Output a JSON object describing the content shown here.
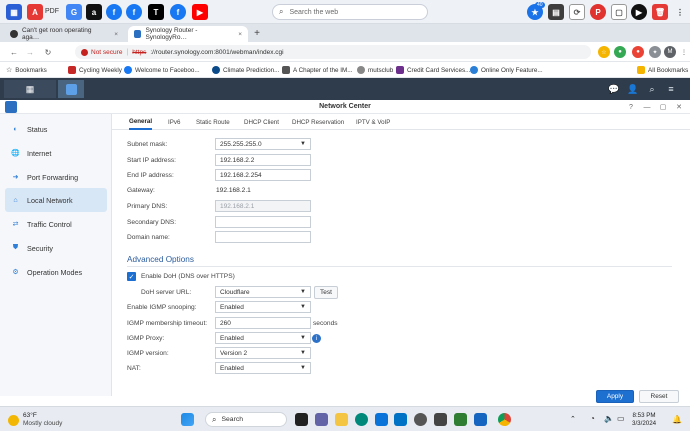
{
  "topbar": {
    "pdf_label": "PDF",
    "search_placeholder": "Search the web",
    "notif_badge": "40"
  },
  "tabs": [
    {
      "label": "Can't get roon operating aga…",
      "close": "×"
    },
    {
      "label": "Synology Router - SynologyRo…",
      "close": "×"
    }
  ],
  "newtab": "+",
  "address": {
    "not_secure": "Not secure",
    "url_insecure": "https",
    "url_rest": "://router.synology.com:8001/webman/index.cgi"
  },
  "bookmarks": [
    "Bookmarks",
    "Cycling Weekly",
    "Welcome to Faceboo...",
    "Climate Prediction...",
    "A Chapter of the IM...",
    "mutsclub",
    "Credit Card Services...",
    "Online Only Feature...",
    "All Bookmarks"
  ],
  "window": {
    "title": "Network Center"
  },
  "sidebar": {
    "items": [
      {
        "label": "Status",
        "icon": "status-icon"
      },
      {
        "label": "Internet",
        "icon": "globe-icon"
      },
      {
        "label": "Port Forwarding",
        "icon": "arrow-icon"
      },
      {
        "label": "Local Network",
        "icon": "house-icon",
        "active": true
      },
      {
        "label": "Traffic Control",
        "icon": "traffic-icon"
      },
      {
        "label": "Security",
        "icon": "shield-icon"
      },
      {
        "label": "Operation Modes",
        "icon": "modes-icon"
      }
    ]
  },
  "subtabs": [
    "General",
    "IPv6",
    "Static Route",
    "DHCP Client",
    "DHCP Reservation",
    "IPTV & VoIP"
  ],
  "form": {
    "subnet_mask": {
      "label": "Subnet mask:",
      "value": "255.255.255.0"
    },
    "start_ip": {
      "label": "Start IP address:",
      "value": "192.168.2.2"
    },
    "end_ip": {
      "label": "End IP address:",
      "value": "192.168.2.254"
    },
    "gateway": {
      "label": "Gateway:",
      "value": "192.168.2.1"
    },
    "primary_dns": {
      "label": "Primary DNS:",
      "value": "192.168.2.1"
    },
    "secondary_dns": {
      "label": "Secondary DNS:",
      "value": ""
    },
    "domain_name": {
      "label": "Domain name:",
      "value": ""
    }
  },
  "advanced": {
    "title": "Advanced Options",
    "doh_label": "Enable DoH (DNS over HTTPS)",
    "doh_url": {
      "label": "DoH server URL:",
      "value": "Cloudflare",
      "test": "Test"
    },
    "igmp_snooping": {
      "label": "Enable IGMP snooping:",
      "value": "Enabled"
    },
    "igmp_timeout": {
      "label": "IGMP membership timeout:",
      "value": "260",
      "unit": "seconds"
    },
    "igmp_proxy": {
      "label": "IGMP Proxy:",
      "value": "Enabled"
    },
    "igmp_version": {
      "label": "IGMP version:",
      "value": "Version 2"
    },
    "nat": {
      "label": "NAT:",
      "value": "Enabled"
    }
  },
  "footer": {
    "apply": "Apply",
    "reset": "Reset"
  },
  "taskbar": {
    "temp": "63°F",
    "weather": "Mostly cloudy",
    "search": "Search",
    "time": "8:53 PM",
    "date": "3/3/2024"
  }
}
